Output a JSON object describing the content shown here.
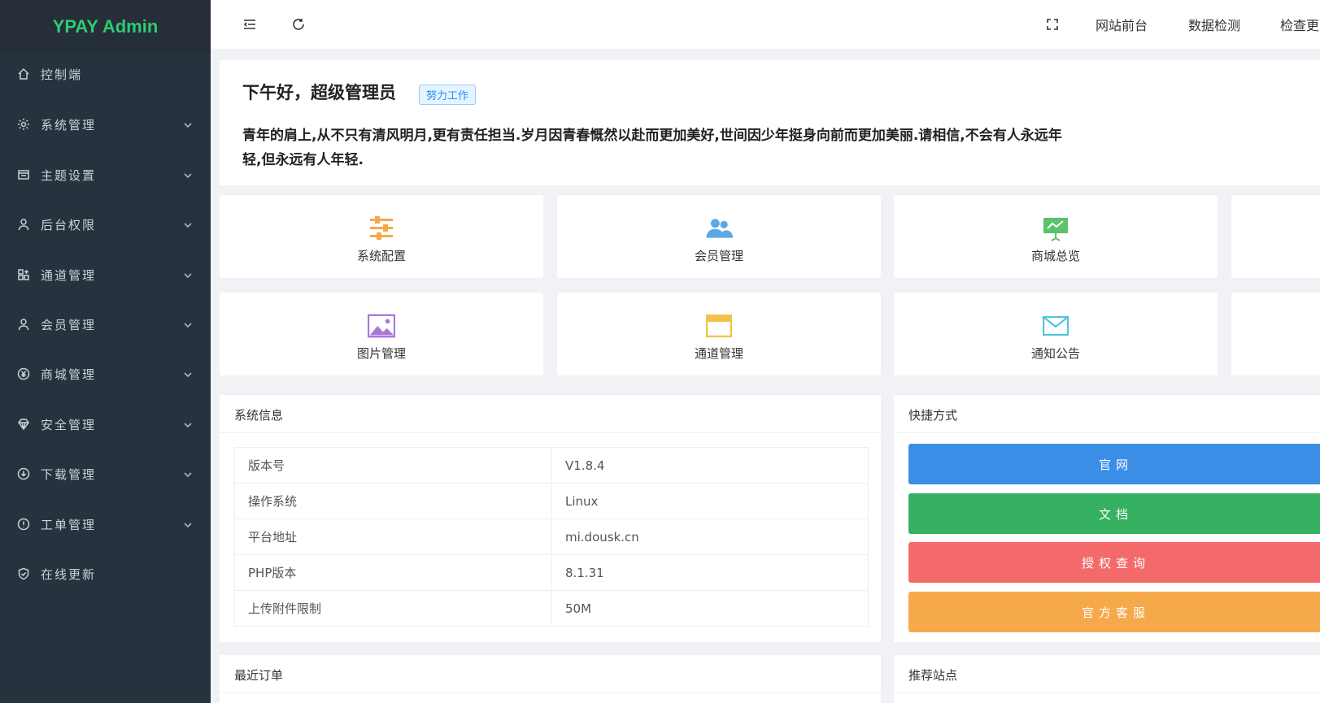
{
  "app": {
    "logo": "YPAY Admin"
  },
  "sidebar": {
    "items": [
      {
        "label": "控制端",
        "icon": "home-icon",
        "has_children": false
      },
      {
        "label": "系统管理",
        "icon": "gear-icon",
        "has_children": true
      },
      {
        "label": "主题设置",
        "icon": "window-icon",
        "has_children": true
      },
      {
        "label": "后台权限",
        "icon": "user-icon",
        "has_children": true
      },
      {
        "label": "通道管理",
        "icon": "grid-icon",
        "has_children": true
      },
      {
        "label": "会员管理",
        "icon": "user-icon",
        "has_children": true
      },
      {
        "label": "商城管理",
        "icon": "yen-icon",
        "has_children": true
      },
      {
        "label": "安全管理",
        "icon": "diamond-icon",
        "has_children": true
      },
      {
        "label": "下载管理",
        "icon": "download-icon",
        "has_children": true
      },
      {
        "label": "工单管理",
        "icon": "info-icon",
        "has_children": true
      },
      {
        "label": "在线更新",
        "icon": "shield-icon",
        "has_children": false
      }
    ]
  },
  "topbar": {
    "links": [
      "网站前台",
      "数据检测",
      "检查更"
    ]
  },
  "welcome": {
    "title": "下午好，超级管理员",
    "badge": "努力工作",
    "quote": "青年的肩上,从不只有清风明月,更有责任担当.岁月因青春慨然以赴而更加美好,世间因少年挺身向前而更加美丽.请相信,不会有人永远年轻,但永远有人年轻."
  },
  "shortcuts": [
    {
      "label": "系统配置",
      "icon": "sliders-icon",
      "color": "#f5a94a"
    },
    {
      "label": "会员管理",
      "icon": "users-icon",
      "color": "#5aa9e6"
    },
    {
      "label": "商城总览",
      "icon": "presentation-icon",
      "color": "#5cc26b"
    },
    {
      "label": "图片管理",
      "icon": "image-icon",
      "color": "#a879d6"
    },
    {
      "label": "通道管理",
      "icon": "window-icon",
      "color": "#f2c24a"
    },
    {
      "label": "通知公告",
      "icon": "mail-icon",
      "color": "#4fc3e0"
    }
  ],
  "system_info": {
    "title": "系统信息",
    "rows": [
      {
        "key": "版本号",
        "value": "V1.8.4"
      },
      {
        "key": "操作系统",
        "value": "Linux"
      },
      {
        "key": "平台地址",
        "value": "mi.dousk.cn"
      },
      {
        "key": "PHP版本",
        "value": "8.1.31"
      },
      {
        "key": "上传附件限制",
        "value": "50M"
      }
    ]
  },
  "quick_links": {
    "title": "快捷方式",
    "buttons": [
      {
        "label": "官网",
        "color": "#3a8ee6"
      },
      {
        "label": "文档",
        "color": "#36b061"
      },
      {
        "label": "授权查询",
        "color": "#f46a6a"
      },
      {
        "label": "官方客服",
        "color": "#f5a94a"
      }
    ]
  },
  "recent_orders": {
    "title": "最近订单"
  },
  "recommended_sites": {
    "title": "推荐站点"
  }
}
